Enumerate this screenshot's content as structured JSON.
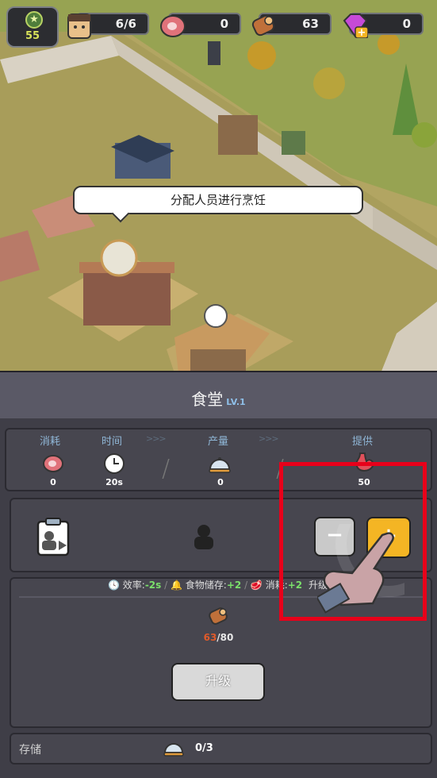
{
  "hud": {
    "level": "55",
    "survivors": "6/6",
    "meat": "0",
    "wood": "63",
    "gems": "0"
  },
  "bubble": "分配人员进行烹饪",
  "panel": {
    "title": "食堂",
    "level": "LV.1",
    "headers": {
      "consume": "消耗",
      "time": "时间",
      "produce": "产量",
      "provide": "提供"
    },
    "stats": {
      "consume": "0",
      "time": "20s",
      "produce": "0",
      "provide": "50"
    },
    "effects": {
      "efficiency_label": "效率:",
      "efficiency_value": "-2s",
      "storage_label": "食物储存:",
      "storage_value": "+2",
      "consume_label": "消耗:",
      "consume_value": "+2",
      "upgrade_attr": "升级属性"
    },
    "cost": {
      "have": "63",
      "need": "/80"
    },
    "upgrade_label": "升级",
    "storage": {
      "label": "存储",
      "value": "0/3"
    }
  },
  "colors": {
    "accent": "#f4b524",
    "highlight": "#e8001a",
    "cost_have": "#e05a2a"
  }
}
